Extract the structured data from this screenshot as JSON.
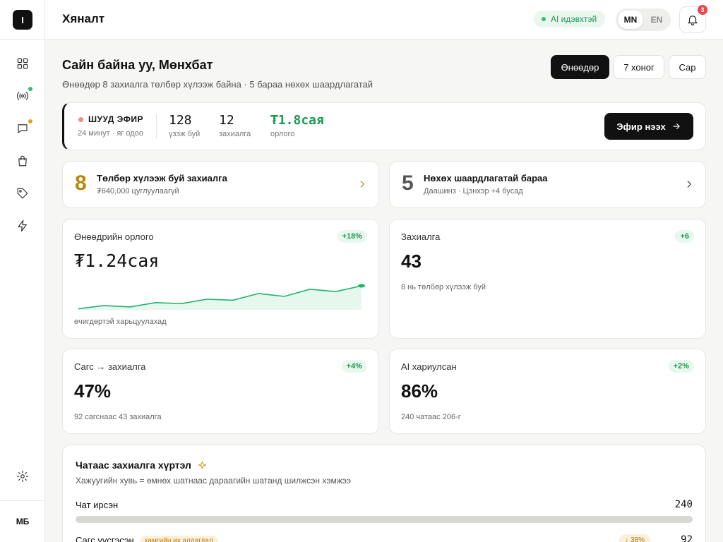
{
  "app": {
    "logo_text": "I",
    "avatar_initials": "МБ"
  },
  "header": {
    "title": "Хяналт",
    "ai_status": "AI идэвхтэй",
    "lang_active": "MN",
    "lang_inactive": "EN",
    "notifications_count": "3"
  },
  "sidebar": {
    "items": [
      {
        "icon": "grid-icon"
      },
      {
        "icon": "broadcast-icon",
        "dot_color": "#2fbf71"
      },
      {
        "icon": "chat-icon",
        "dot_color": "#d9a418"
      },
      {
        "icon": "shopping-bag-icon"
      },
      {
        "icon": "tag-icon"
      },
      {
        "icon": "lightning-icon"
      }
    ],
    "settings_icon": "gear-icon"
  },
  "greeting": {
    "title": "Сайн байна уу, Мөнхбат",
    "subtitle": "Өнөөдөр 8 захиалга төлбөр хүлээж байна · 5 бараа нөхөх шаардлагатай"
  },
  "range": {
    "today": "Өнөөдөр",
    "week": "7 хоног",
    "month": "Сар",
    "selected": "Өнөөдөр"
  },
  "live": {
    "label": "ШУУД ЭФИР",
    "time": "24 минут · яг одоо",
    "viewers_value": "128",
    "viewers_label": "үзэж буй",
    "orders_value": "12",
    "orders_label": "захиалга",
    "revenue_value": "₮1.8сая",
    "revenue_label": "орлого",
    "cta": "Эфир нээх"
  },
  "alerts": [
    {
      "number": "8",
      "number_color": "#b8860b",
      "title": "Төлбөр хүлээж буй захиалга",
      "subtitle": "₮640,000 цуглуулаагүй"
    },
    {
      "number": "5",
      "number_color": "#555555",
      "title": "Нөхөх шаардлагатай бараа",
      "subtitle": "Даашинз · Цэнхэр +4 бусад"
    }
  ],
  "metrics": {
    "revenue": {
      "title": "Өнөөдрийн орлого",
      "delta": "+18%",
      "value": "₮1.24сая",
      "note": "өчигдөртэй харьцуулахад"
    },
    "orders": {
      "title": "Захиалга",
      "delta": "+6",
      "value": "43",
      "note": "8 нь төлбөр хүлээж буй"
    },
    "cart": {
      "title": "Сагс → захиалга",
      "delta": "+4%",
      "value": "47%",
      "note": "92 сагснаас 43 захиалга"
    },
    "ai": {
      "title": "AI хариулсан",
      "delta": "+2%",
      "value": "86%",
      "note": "240 чатаас 206-г"
    }
  },
  "chart_data": {
    "type": "area",
    "values": [
      0.2,
      0.9,
      0.6,
      1.5,
      1.3,
      2.2,
      2.0,
      3.4,
      2.8,
      4.3,
      3.8,
      5.0
    ]
  },
  "funnel": {
    "title": "Чатаас захиалга хүртэл",
    "subtitle": "Хажуугийн хувь = өмнөх шатнаас дараагийн шатанд шилжсэн хэмжээ",
    "rows": [
      {
        "label": "Чат ирсэн",
        "value": "240",
        "fill": 1.0
      },
      {
        "label": "Сагс үүсгэсэн",
        "tag": "хамгийн их алдагдал",
        "drop": "↓ 38%",
        "value": "92"
      }
    ]
  },
  "colors": {
    "accent": "#111111",
    "positive": "#1a9a55",
    "warning": "#b07a12",
    "alert_badge": "#e5484d"
  }
}
